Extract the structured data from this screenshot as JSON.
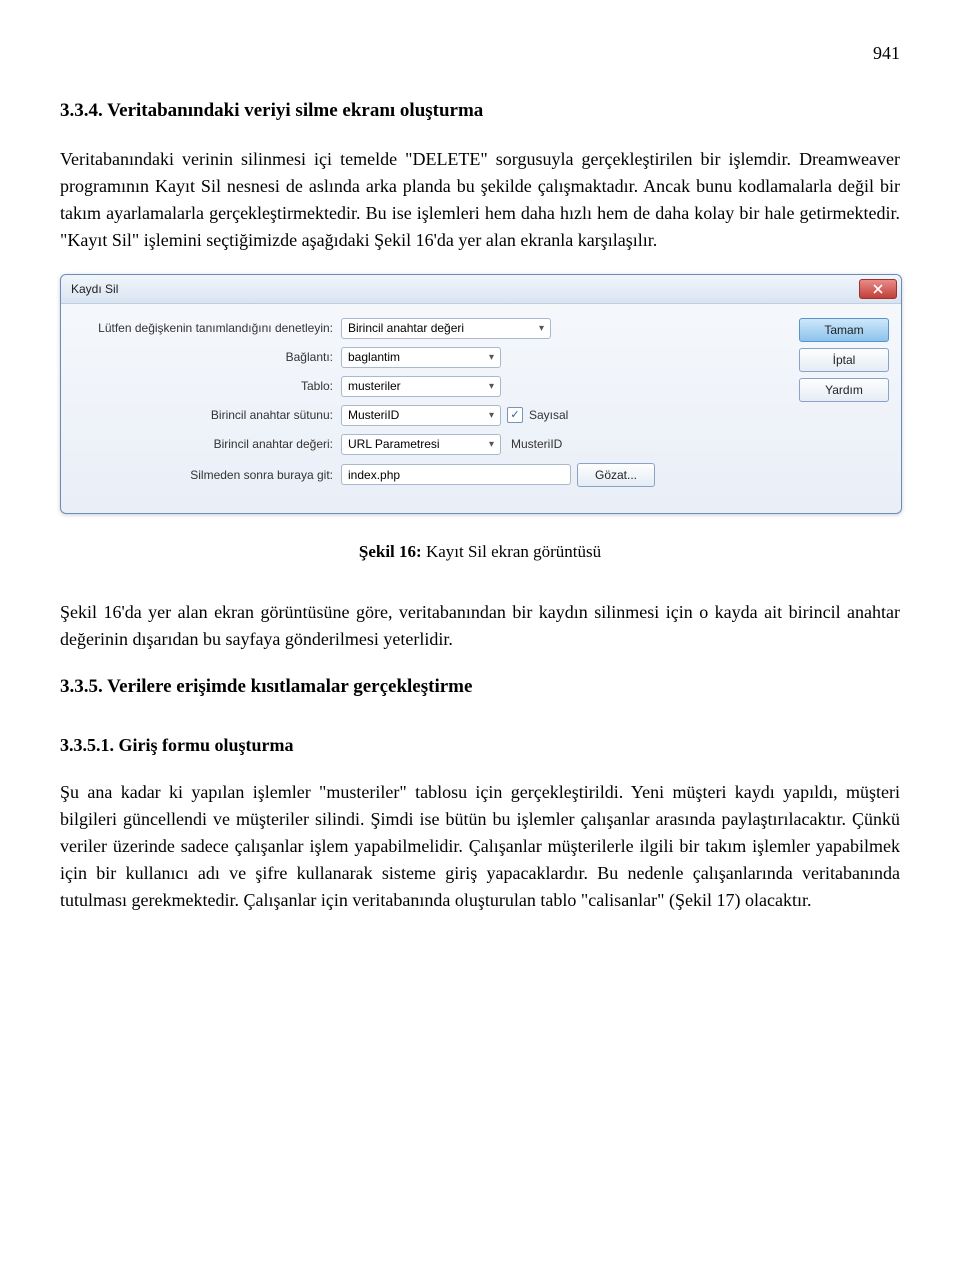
{
  "page_number": "941",
  "section_heading": "3.3.4. Veritabanındaki veriyi silme ekranı oluşturma",
  "paragraph1": "Veritabanındaki verinin silinmesi içi temelde \"DELETE\" sorgusuyla gerçekleştirilen bir işlemdir. Dreamweaver programının Kayıt Sil nesnesi de aslında arka planda bu şekilde çalışmaktadır. Ancak bunu kodlamalarla değil bir takım ayarlamalarla gerçekleştirmektedir. Bu ise işlemleri hem daha hızlı hem de daha kolay bir hale getirmektedir. \"Kayıt Sil\" işlemini seçtiğimizde aşağıdaki Şekil 16'da yer alan ekranla karşılaşılır.",
  "dialog": {
    "title": "Kaydı Sil",
    "labels": {
      "check_var": "Lütfen değişkenin tanımlandığını denetleyin:",
      "connection": "Bağlantı:",
      "table": "Tablo:",
      "pk_column": "Birincil anahtar sütunu:",
      "pk_value": "Birincil anahtar değeri:",
      "after_delete": "Silmeden sonra buraya git:"
    },
    "values": {
      "check_var": "Birincil anahtar değeri",
      "connection": "baglantim",
      "table": "musteriler",
      "pk_column": "MusteriID",
      "pk_value_type": "URL Parametresi",
      "pk_value_name": "MusteriID",
      "after_delete": "index.php",
      "numeric_label": "Sayısal",
      "numeric_check": "✓"
    },
    "buttons": {
      "ok": "Tamam",
      "cancel": "İptal",
      "help": "Yardım",
      "browse": "Gözat..."
    }
  },
  "figure_caption_bold": "Şekil 16:",
  "figure_caption_rest": " Kayıt Sil ekran görüntüsü",
  "paragraph2": "Şekil 16'da yer alan ekran görüntüsüne göre, veritabanından bir kaydın silinmesi için o kayda ait birincil anahtar değerinin dışarıdan bu sayfaya gönderilmesi yeterlidir.",
  "section_heading2": "3.3.5. Verilere erişimde kısıtlamalar gerçekleştirme",
  "sub_heading": "3.3.5.1. Giriş formu oluşturma",
  "paragraph3": "Şu ana kadar ki yapılan işlemler \"musteriler\" tablosu için gerçekleştirildi. Yeni müşteri kaydı yapıldı, müşteri bilgileri güncellendi ve müşteriler silindi. Şimdi ise bütün bu işlemler çalışanlar arasında paylaştırılacaktır. Çünkü veriler üzerinde sadece çalışanlar işlem yapabilmelidir. Çalışanlar müşterilerle ilgili bir takım işlemler yapabilmek için bir kullanıcı adı ve şifre kullanarak sisteme giriş yapacaklardır. Bu nedenle çalışanlarında veritabanında tutulması gerekmektedir. Çalışanlar için veritabanında oluşturulan tablo \"calisanlar\" (Şekil 17) olacaktır."
}
